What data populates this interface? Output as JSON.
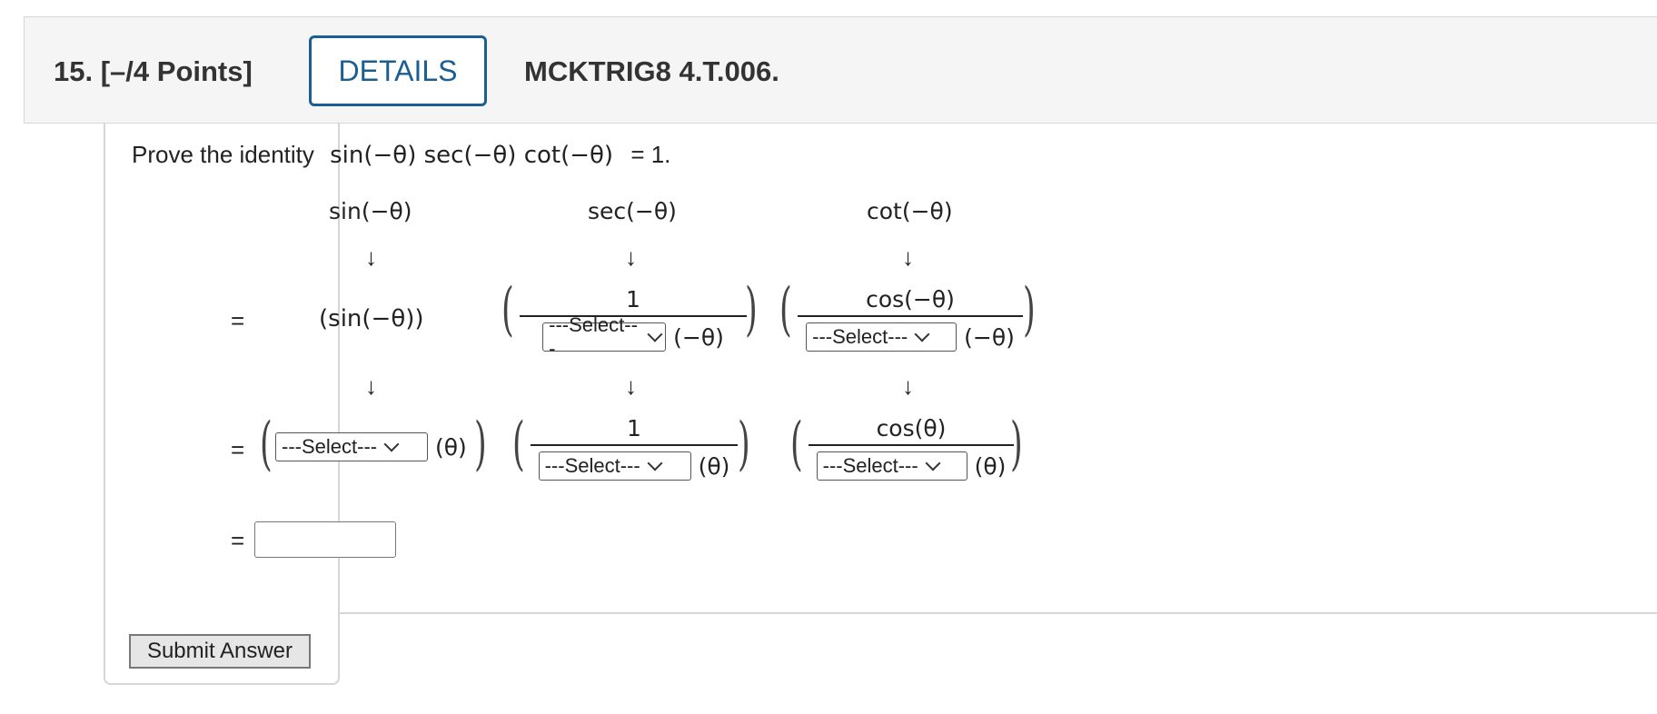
{
  "header": {
    "question_number": "15.",
    "points": "[–/4 Points]",
    "details_label": "DETAILS",
    "question_code": "MCKTRIG8 4.T.006."
  },
  "prompt": {
    "text": "Prove the identity",
    "identity": "sin(−θ) sec(−θ) cot(−θ)",
    "equals": "= 1."
  },
  "columns": {
    "sin_head": "sin(−θ)",
    "sec_head": "sec(−θ)",
    "cot_head": "cot(−θ)",
    "arrow": "↓"
  },
  "row1": {
    "equals": "=",
    "sin_expr": "(sin(−θ))",
    "sec_num": "1",
    "sec_arg": "(−θ)",
    "cot_num": "cos(−θ)",
    "cot_arg": "(−θ)"
  },
  "row2": {
    "equals": "=",
    "sin_arg": "(θ)",
    "sec_num": "1",
    "sec_arg": "(θ)",
    "cot_num": "cos(θ)",
    "cot_arg": "(θ)"
  },
  "row3": {
    "equals": "=",
    "answer_value": ""
  },
  "select_placeholder": "---Select---",
  "submit_label": "Submit Answer"
}
